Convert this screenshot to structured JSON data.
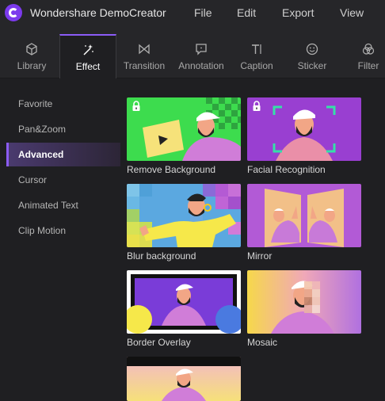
{
  "app": {
    "title": "Wondershare DemoCreator"
  },
  "menu": [
    "File",
    "Edit",
    "Export",
    "View"
  ],
  "tabs": [
    {
      "label": "Library",
      "icon": "cube-icon"
    },
    {
      "label": "Effect",
      "icon": "magic-wand-icon",
      "active": true
    },
    {
      "label": "Transition",
      "icon": "transition-icon"
    },
    {
      "label": "Annotation",
      "icon": "annotation-icon"
    },
    {
      "label": "Caption",
      "icon": "caption-icon"
    },
    {
      "label": "Sticker",
      "icon": "smiley-icon"
    },
    {
      "label": "Filter",
      "icon": "filter-icon"
    }
  ],
  "sidebar": {
    "items": [
      {
        "label": "Favorite"
      },
      {
        "label": "Pan&Zoom"
      },
      {
        "label": "Advanced",
        "active": true
      },
      {
        "label": "Cursor"
      },
      {
        "label": "Animated Text"
      },
      {
        "label": "Clip Motion"
      }
    ]
  },
  "effects": [
    {
      "label": "Remove Background",
      "locked": true
    },
    {
      "label": "Facial Recognition",
      "locked": true
    },
    {
      "label": "Blur background"
    },
    {
      "label": "Mirror"
    },
    {
      "label": "Border Overlay"
    },
    {
      "label": "Mosaic"
    },
    {
      "label": ""
    }
  ],
  "colors": {
    "accent": "#8b5cf6",
    "background": "#1f1f22",
    "panel": "#262629"
  }
}
